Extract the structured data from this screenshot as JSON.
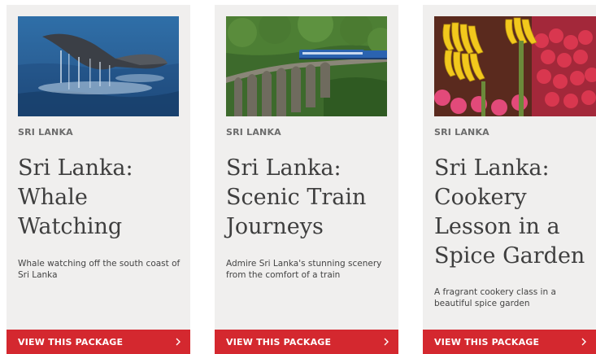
{
  "cards": [
    {
      "region": "SRI LANKA",
      "title": "Sri Lanka: Whale Watching",
      "description": "Whale watching off the south coast of Sri Lanka",
      "cta_label": "VIEW THIS PACKAGE",
      "image_subject": "whale-tail-photo"
    },
    {
      "region": "SRI LANKA",
      "title": "Sri Lanka: Scenic Train Journeys",
      "description": "Admire Sri Lanka's stunning scenery from the comfort of a train",
      "cta_label": "VIEW THIS PACKAGE",
      "image_subject": "train-on-bridge-photo"
    },
    {
      "region": "SRI LANKA",
      "title": "Sri Lanka: Cookery Lesson in a Spice Garden",
      "description": "A fragrant cookery class in a beautiful spice garden",
      "cta_label": "VIEW THIS PACKAGE",
      "image_subject": "bananas-market-photo"
    }
  ],
  "colors": {
    "card_background": "#f0efee",
    "cta_background": "#d4282f",
    "cta_text": "#ffffff",
    "title_text": "#3e3e3e",
    "region_text": "#6b6b6b"
  },
  "icons": {
    "cta_icon": "chevron-right-icon"
  }
}
